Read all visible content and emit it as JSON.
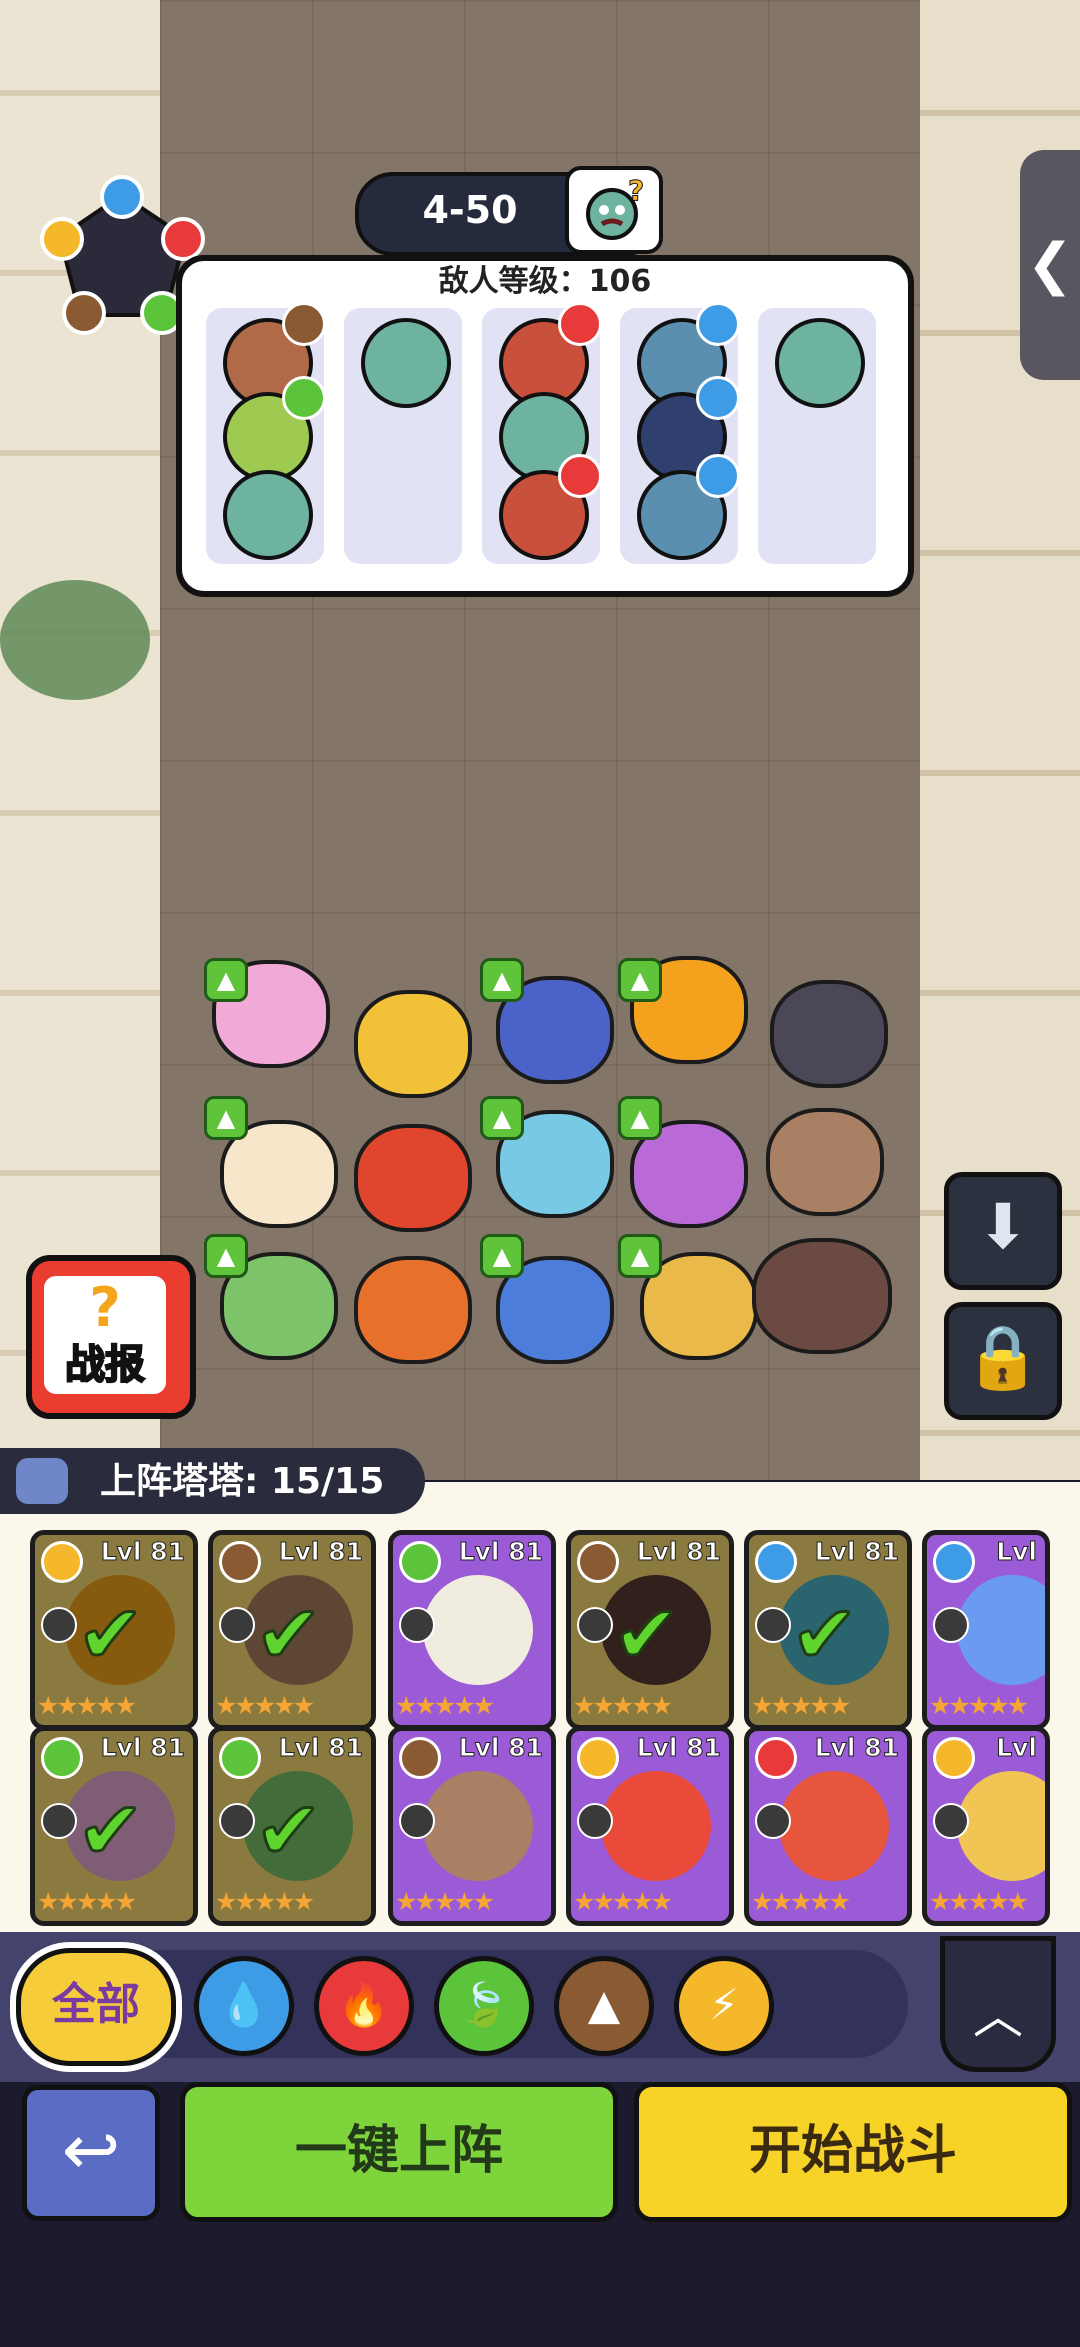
{
  "level": {
    "stage": "4-50"
  },
  "enemy_panel": {
    "title": "敌人等级：106"
  },
  "report_button": {
    "label": "战报",
    "mark": "?"
  },
  "roster": {
    "title": "上阵塔塔: 15/15"
  },
  "cards": [
    {
      "level": "Lvl 81",
      "element": "lightning",
      "deployed": true
    },
    {
      "level": "Lvl 81",
      "element": "earth",
      "deployed": true
    },
    {
      "level": "Lvl 81",
      "element": "grass",
      "deployed": false
    },
    {
      "level": "Lvl 81",
      "element": "earth",
      "deployed": true
    },
    {
      "level": "Lvl 81",
      "element": "water",
      "deployed": true
    },
    {
      "level": "Lvl",
      "element": "water",
      "deployed": false
    },
    {
      "level": "Lvl 81",
      "element": "grass",
      "deployed": true
    },
    {
      "level": "Lvl 81",
      "element": "grass",
      "deployed": true
    },
    {
      "level": "Lvl 81",
      "element": "earth",
      "deployed": false
    },
    {
      "level": "Lvl 81",
      "element": "lightning",
      "deployed": false
    },
    {
      "level": "Lvl 81",
      "element": "fire",
      "deployed": false
    },
    {
      "level": "Lvl",
      "element": "lightning",
      "deployed": false
    }
  ],
  "filter": {
    "all_label": "全部",
    "elements": [
      "water",
      "fire",
      "grass",
      "earth",
      "lightning"
    ]
  },
  "actions": {
    "auto_deploy": "一键上阵",
    "start_battle": "开始战斗"
  },
  "colors": {
    "water": "#3e9be6",
    "fire": "#e83a3a",
    "grass": "#5cc43a",
    "earth": "#8a5a32",
    "lightning": "#f5b82a"
  }
}
